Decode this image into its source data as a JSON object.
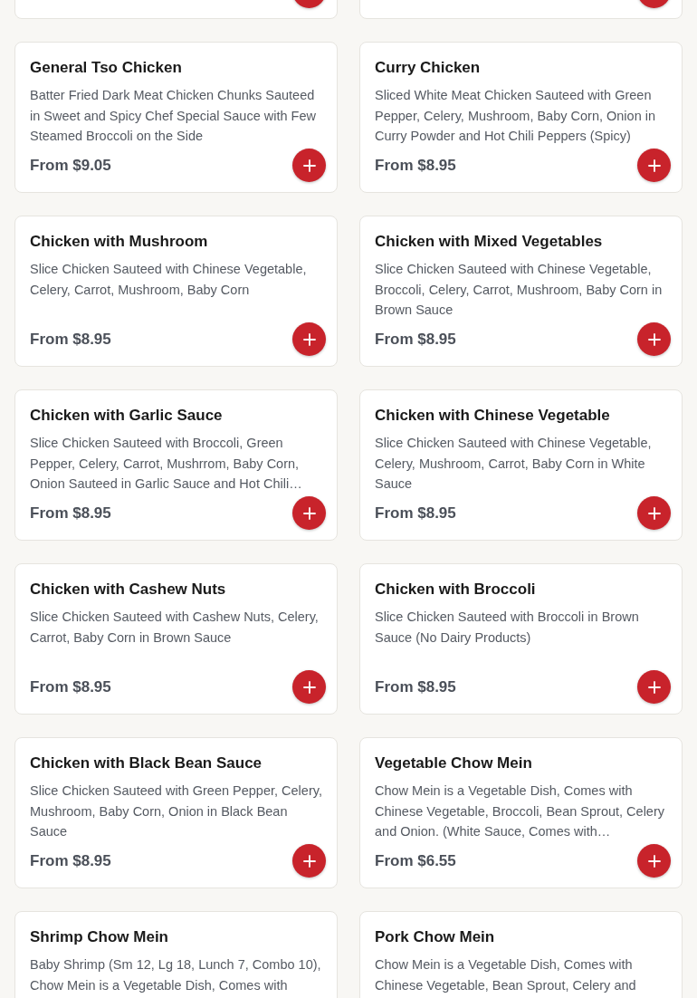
{
  "menu_items": [
    {
      "kind": "cut"
    },
    {
      "kind": "cut"
    },
    {
      "kind": "full",
      "name": "General Tso Chicken",
      "description": "Batter Fried Dark Meat Chicken Chunks Sauteed in Sweet and Spicy Chef Special Sauce with Few Steamed Broccoli on the Side",
      "price": "From $9.05"
    },
    {
      "kind": "full",
      "name": "Curry Chicken",
      "description": "Sliced White Meat Chicken Sauteed with Green Pepper, Celery, Mushroom, Baby Corn, Onion in Curry Powder and Hot Chili Peppers (Spicy)",
      "price": "From $8.95"
    },
    {
      "kind": "full",
      "name": "Chicken with Mushroom",
      "description": "Slice Chicken Sauteed with Chinese Vegetable, Celery, Carrot, Mushroom, Baby Corn",
      "price": "From $8.95"
    },
    {
      "kind": "full",
      "name": "Chicken with Mixed Vegetables",
      "description": "Slice Chicken Sauteed with Chinese Vegetable, Broccoli, Celery, Carrot, Mushroom, Baby Corn in Brown Sauce",
      "price": "From $8.95"
    },
    {
      "kind": "full",
      "name": "Chicken with Garlic Sauce",
      "description": "Slice Chicken Sauteed with Broccoli, Green Pepper, Celery, Carrot, Mushrrom, Baby Corn, Onion Sauteed in Garlic Sauce and Hot Chili…",
      "price": "From $8.95"
    },
    {
      "kind": "full",
      "name": "Chicken with Chinese Vegetable",
      "description": "Slice Chicken Sauteed with Chinese Vegetable, Celery, Mushroom, Carrot, Baby Corn in White Sauce",
      "price": "From $8.95"
    },
    {
      "kind": "full",
      "name": "Chicken with Cashew Nuts",
      "description": "Slice Chicken Sauteed with Cashew Nuts, Celery, Carrot, Baby Corn in Brown Sauce",
      "price": "From $8.95"
    },
    {
      "kind": "full",
      "name": "Chicken with Broccoli",
      "description": "Slice Chicken Sauteed with Broccoli in Brown Sauce (No Dairy Products)",
      "price": "From $8.95"
    },
    {
      "kind": "full",
      "name": "Chicken with Black Bean Sauce",
      "description": "Slice Chicken Sauteed with Green Pepper, Celery, Mushroom, Baby Corn, Onion in Black Bean Sauce",
      "price": "From $8.95"
    },
    {
      "kind": "full",
      "name": "Vegetable Chow Mein",
      "description": "Chow Mein is a Vegetable Dish, Comes with Chinese Vegetable, Broccoli, Bean Sprout, Celery and Onion. (White Sauce, Comes with…",
      "price": "From $6.55"
    },
    {
      "kind": "bottom",
      "name": "Shrimp Chow Mein",
      "description": "Baby Shrimp (Sm 12, Lg 18, Lunch 7, Combo 10), Chow Mein is a Vegetable Dish, Comes with"
    },
    {
      "kind": "bottom",
      "name": "Pork Chow Mein",
      "description": "Chow Mein is a Vegetable Dish, Comes with Chinese Vegetable, Bean Sprout, Celery and"
    }
  ]
}
